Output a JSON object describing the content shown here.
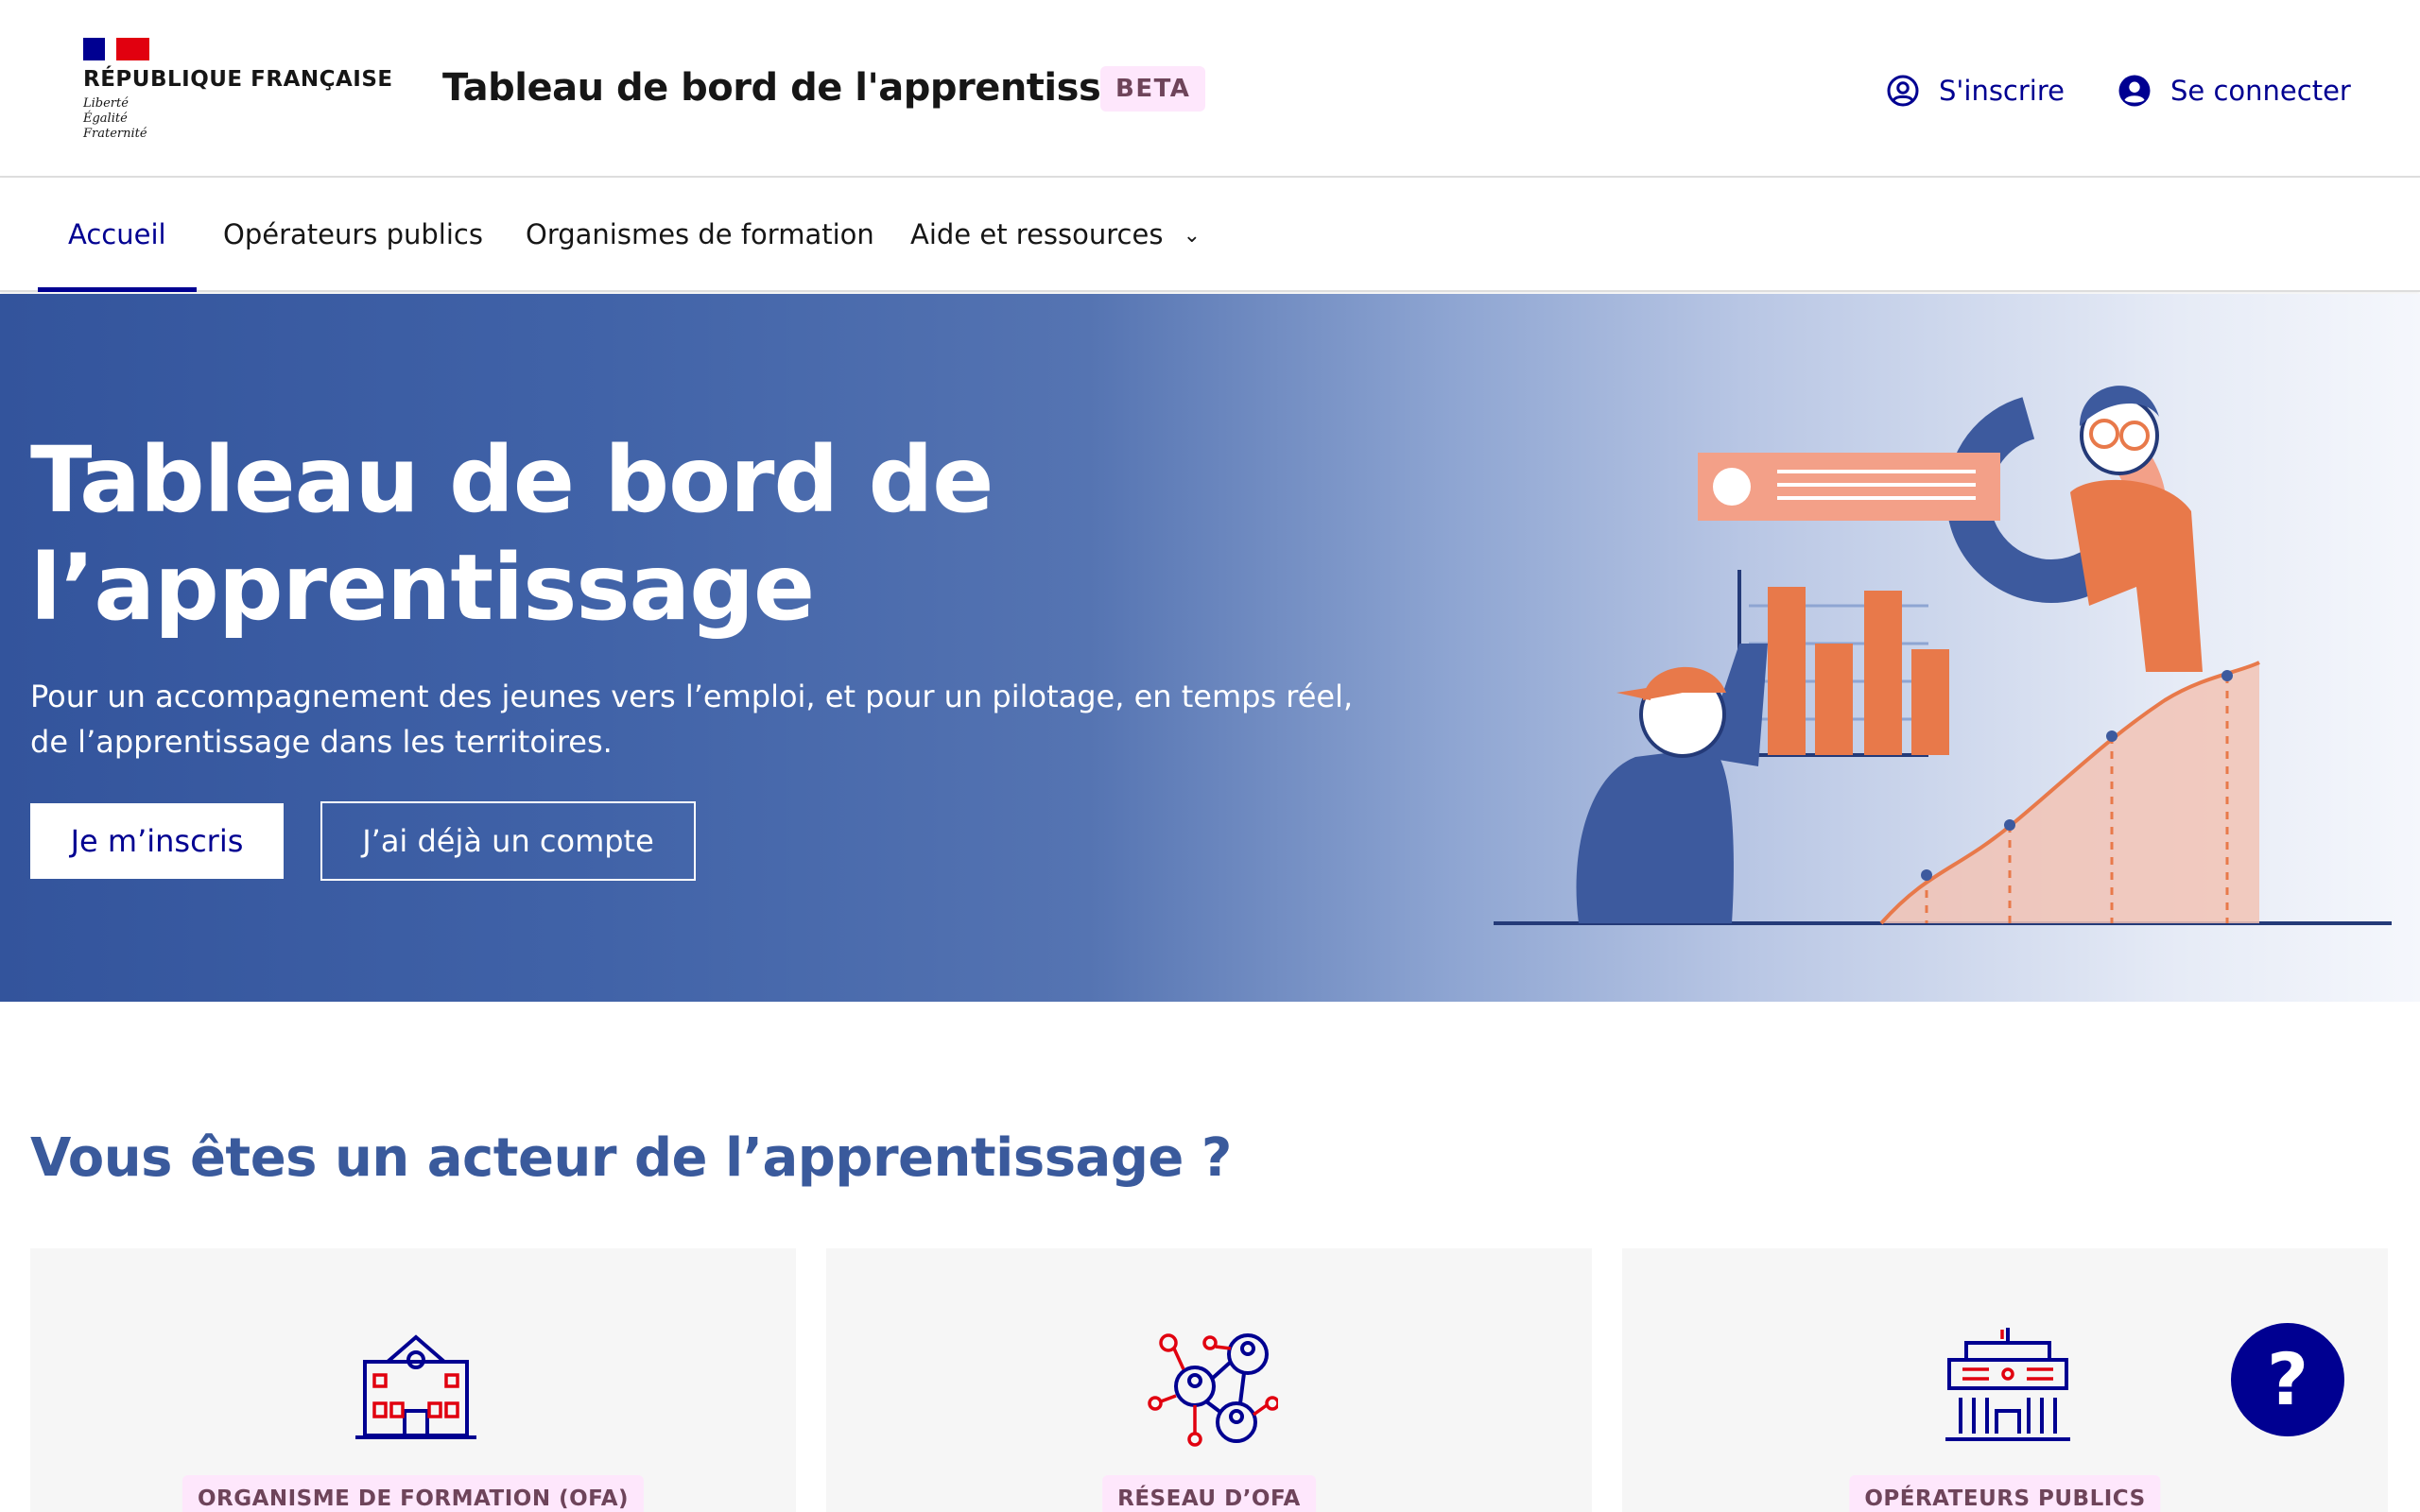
{
  "header": {
    "republic": "RÉPUBLIQUE FRANÇAISE",
    "motto": [
      "Liberté",
      "Égalité",
      "Fraternité"
    ],
    "service_title": "Tableau de bord de l'apprentissage",
    "beta_badge": "BETA",
    "links": [
      {
        "label": "S'inscrire",
        "icon": "user-circle-icon"
      },
      {
        "label": "Se connecter",
        "icon": "account-circle-icon"
      }
    ]
  },
  "nav": {
    "items": [
      {
        "label": "Accueil",
        "active": true
      },
      {
        "label": "Opérateurs publics"
      },
      {
        "label": "Organismes de formation"
      },
      {
        "label": "Aide et ressources",
        "icon": "chevron-down-icon",
        "chevron": "⌄"
      }
    ]
  },
  "hero": {
    "title_line1": "Tableau de bord de",
    "title_line2": "l’apprentissage",
    "subtitle": "Pour un accompagnement des jeunes vers l’emploi, et pour un pilotage, en temps réel, de l’apprentissage dans les territoires.",
    "primary_button": "Je m’inscris",
    "secondary_button": "J’ai déjà un compte"
  },
  "actors": {
    "title": "Vous êtes un acteur de l’apprentissage ?",
    "cards": [
      {
        "badge": "ORGANISME DE FORMATION (OFA)",
        "icon": "school-building-icon"
      },
      {
        "badge": "RÉSEAU D’OFA",
        "icon": "network-people-icon"
      },
      {
        "badge": "OPÉRATEURS PUBLICS",
        "icon": "public-building-icon"
      }
    ]
  },
  "help_button": "?",
  "colors": {
    "primary": "#000091",
    "badge_bg": "#fee7fc",
    "badge_text": "#6e445a",
    "hero_blue": "#33549c",
    "illustration_orange": "#e8794a",
    "section_title": "#3a5a9c",
    "marianne_red": "#e1000f"
  }
}
